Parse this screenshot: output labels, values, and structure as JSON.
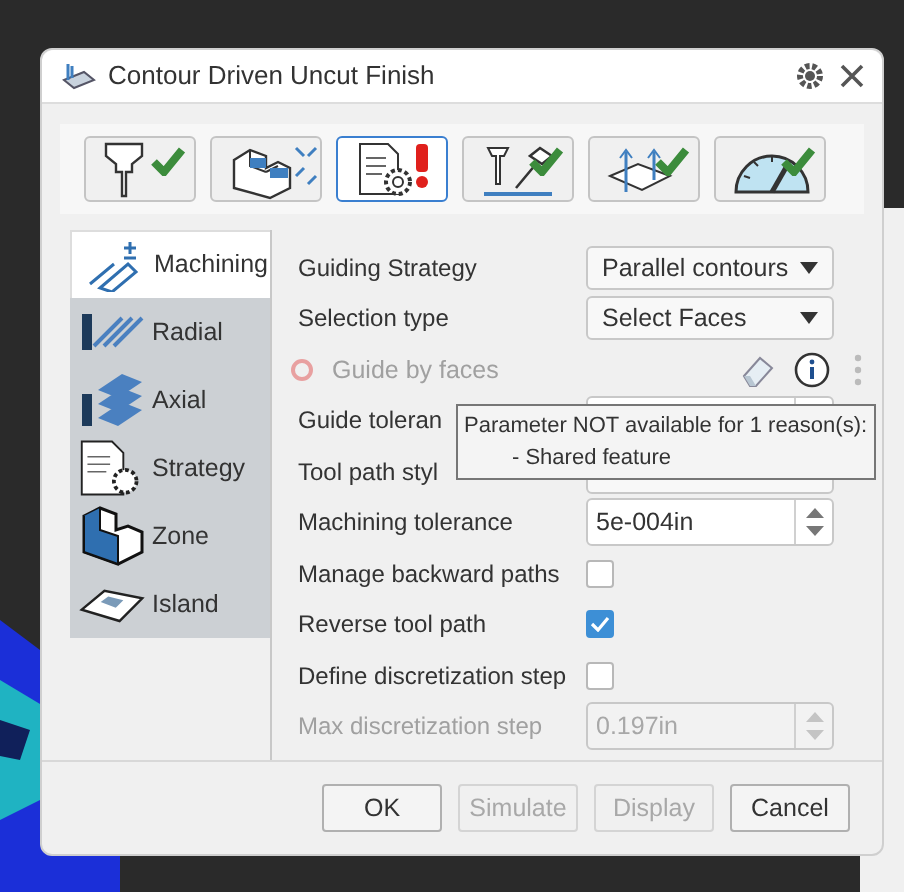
{
  "window": {
    "title": "Contour Driven Uncut Finish"
  },
  "tool_tabs": [
    {
      "kind": "tool",
      "complete": true,
      "warning": false,
      "selected": false
    },
    {
      "kind": "part",
      "complete": false,
      "warning": false,
      "selected": false
    },
    {
      "kind": "strategy",
      "complete": false,
      "warning": true,
      "selected": true
    },
    {
      "kind": "approach",
      "complete": true,
      "warning": false,
      "selected": false
    },
    {
      "kind": "feed",
      "complete": true,
      "warning": false,
      "selected": false
    },
    {
      "kind": "speed",
      "complete": true,
      "warning": false,
      "selected": false
    }
  ],
  "sidebar": {
    "items": [
      {
        "kind": "machining",
        "label": "Machining",
        "selected": true
      },
      {
        "kind": "radial",
        "label": "Radial",
        "selected": false
      },
      {
        "kind": "axial",
        "label": "Axial",
        "selected": false
      },
      {
        "kind": "strategy",
        "label": "Strategy",
        "selected": false
      },
      {
        "kind": "zone",
        "label": "Zone",
        "selected": false
      },
      {
        "kind": "island",
        "label": "Island",
        "selected": false
      }
    ]
  },
  "form": [
    {
      "kind": "select",
      "label": "Guiding Strategy",
      "value": "Parallel contours",
      "disabled": false
    },
    {
      "kind": "select",
      "label": "Selection type",
      "value": "Select Faces",
      "disabled": false
    },
    {
      "kind": "selector",
      "label": "Guide by faces",
      "disabled": true
    },
    {
      "kind": "spin",
      "label": "Guide toleran",
      "disabled": false
    },
    {
      "kind": "select",
      "label": "Tool path styl",
      "disabled": false
    },
    {
      "kind": "spin",
      "label": "Machining tolerance",
      "value": "5e-004in",
      "disabled": false
    },
    {
      "kind": "checkbox",
      "label": "Manage backward paths",
      "checked": false,
      "disabled": false
    },
    {
      "kind": "checkbox",
      "label": "Reverse tool path",
      "checked": true,
      "disabled": false
    },
    {
      "kind": "checkbox",
      "label": "Define discretization step",
      "checked": false,
      "disabled": false
    },
    {
      "kind": "spin",
      "label": "Max discretization step",
      "value": "0.197in",
      "disabled": true
    }
  ],
  "tooltip": {
    "lines": [
      "Parameter NOT available for 1 reason(s):",
      "- Shared feature"
    ]
  },
  "buttons": [
    {
      "label": "OK",
      "disabled": false
    },
    {
      "label": "Simulate",
      "disabled": true
    },
    {
      "label": "Display",
      "disabled": true
    },
    {
      "label": "Cancel",
      "disabled": false
    }
  ]
}
